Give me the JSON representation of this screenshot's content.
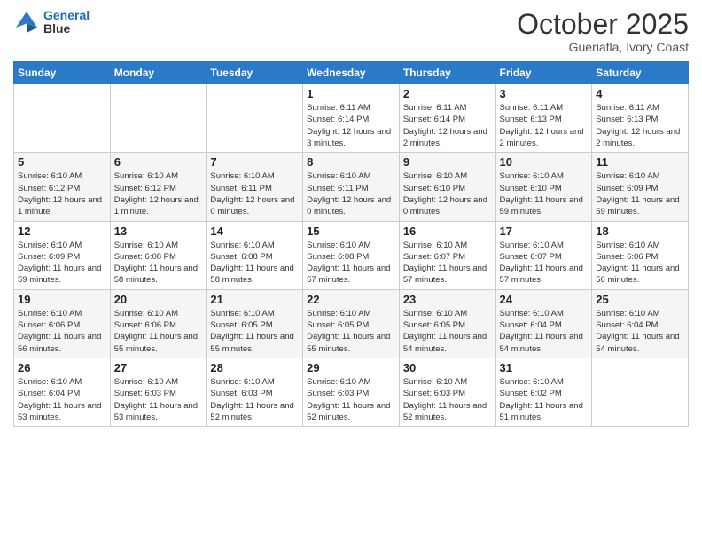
{
  "header": {
    "logo_line1": "General",
    "logo_line2": "Blue",
    "month": "October 2025",
    "location": "Gueriafla, Ivory Coast"
  },
  "weekdays": [
    "Sunday",
    "Monday",
    "Tuesday",
    "Wednesday",
    "Thursday",
    "Friday",
    "Saturday"
  ],
  "weeks": [
    [
      {
        "day": "",
        "info": ""
      },
      {
        "day": "",
        "info": ""
      },
      {
        "day": "",
        "info": ""
      },
      {
        "day": "1",
        "info": "Sunrise: 6:11 AM\nSunset: 6:14 PM\nDaylight: 12 hours\nand 3 minutes."
      },
      {
        "day": "2",
        "info": "Sunrise: 6:11 AM\nSunset: 6:14 PM\nDaylight: 12 hours\nand 2 minutes."
      },
      {
        "day": "3",
        "info": "Sunrise: 6:11 AM\nSunset: 6:13 PM\nDaylight: 12 hours\nand 2 minutes."
      },
      {
        "day": "4",
        "info": "Sunrise: 6:11 AM\nSunset: 6:13 PM\nDaylight: 12 hours\nand 2 minutes."
      }
    ],
    [
      {
        "day": "5",
        "info": "Sunrise: 6:10 AM\nSunset: 6:12 PM\nDaylight: 12 hours\nand 1 minute."
      },
      {
        "day": "6",
        "info": "Sunrise: 6:10 AM\nSunset: 6:12 PM\nDaylight: 12 hours\nand 1 minute."
      },
      {
        "day": "7",
        "info": "Sunrise: 6:10 AM\nSunset: 6:11 PM\nDaylight: 12 hours\nand 0 minutes."
      },
      {
        "day": "8",
        "info": "Sunrise: 6:10 AM\nSunset: 6:11 PM\nDaylight: 12 hours\nand 0 minutes."
      },
      {
        "day": "9",
        "info": "Sunrise: 6:10 AM\nSunset: 6:10 PM\nDaylight: 12 hours\nand 0 minutes."
      },
      {
        "day": "10",
        "info": "Sunrise: 6:10 AM\nSunset: 6:10 PM\nDaylight: 11 hours\nand 59 minutes."
      },
      {
        "day": "11",
        "info": "Sunrise: 6:10 AM\nSunset: 6:09 PM\nDaylight: 11 hours\nand 59 minutes."
      }
    ],
    [
      {
        "day": "12",
        "info": "Sunrise: 6:10 AM\nSunset: 6:09 PM\nDaylight: 11 hours\nand 59 minutes."
      },
      {
        "day": "13",
        "info": "Sunrise: 6:10 AM\nSunset: 6:08 PM\nDaylight: 11 hours\nand 58 minutes."
      },
      {
        "day": "14",
        "info": "Sunrise: 6:10 AM\nSunset: 6:08 PM\nDaylight: 11 hours\nand 58 minutes."
      },
      {
        "day": "15",
        "info": "Sunrise: 6:10 AM\nSunset: 6:08 PM\nDaylight: 11 hours\nand 57 minutes."
      },
      {
        "day": "16",
        "info": "Sunrise: 6:10 AM\nSunset: 6:07 PM\nDaylight: 11 hours\nand 57 minutes."
      },
      {
        "day": "17",
        "info": "Sunrise: 6:10 AM\nSunset: 6:07 PM\nDaylight: 11 hours\nand 57 minutes."
      },
      {
        "day": "18",
        "info": "Sunrise: 6:10 AM\nSunset: 6:06 PM\nDaylight: 11 hours\nand 56 minutes."
      }
    ],
    [
      {
        "day": "19",
        "info": "Sunrise: 6:10 AM\nSunset: 6:06 PM\nDaylight: 11 hours\nand 56 minutes."
      },
      {
        "day": "20",
        "info": "Sunrise: 6:10 AM\nSunset: 6:06 PM\nDaylight: 11 hours\nand 55 minutes."
      },
      {
        "day": "21",
        "info": "Sunrise: 6:10 AM\nSunset: 6:05 PM\nDaylight: 11 hours\nand 55 minutes."
      },
      {
        "day": "22",
        "info": "Sunrise: 6:10 AM\nSunset: 6:05 PM\nDaylight: 11 hours\nand 55 minutes."
      },
      {
        "day": "23",
        "info": "Sunrise: 6:10 AM\nSunset: 6:05 PM\nDaylight: 11 hours\nand 54 minutes."
      },
      {
        "day": "24",
        "info": "Sunrise: 6:10 AM\nSunset: 6:04 PM\nDaylight: 11 hours\nand 54 minutes."
      },
      {
        "day": "25",
        "info": "Sunrise: 6:10 AM\nSunset: 6:04 PM\nDaylight: 11 hours\nand 54 minutes."
      }
    ],
    [
      {
        "day": "26",
        "info": "Sunrise: 6:10 AM\nSunset: 6:04 PM\nDaylight: 11 hours\nand 53 minutes."
      },
      {
        "day": "27",
        "info": "Sunrise: 6:10 AM\nSunset: 6:03 PM\nDaylight: 11 hours\nand 53 minutes."
      },
      {
        "day": "28",
        "info": "Sunrise: 6:10 AM\nSunset: 6:03 PM\nDaylight: 11 hours\nand 52 minutes."
      },
      {
        "day": "29",
        "info": "Sunrise: 6:10 AM\nSunset: 6:03 PM\nDaylight: 11 hours\nand 52 minutes."
      },
      {
        "day": "30",
        "info": "Sunrise: 6:10 AM\nSunset: 6:03 PM\nDaylight: 11 hours\nand 52 minutes."
      },
      {
        "day": "31",
        "info": "Sunrise: 6:10 AM\nSunset: 6:02 PM\nDaylight: 11 hours\nand 51 minutes."
      },
      {
        "day": "",
        "info": ""
      }
    ]
  ]
}
